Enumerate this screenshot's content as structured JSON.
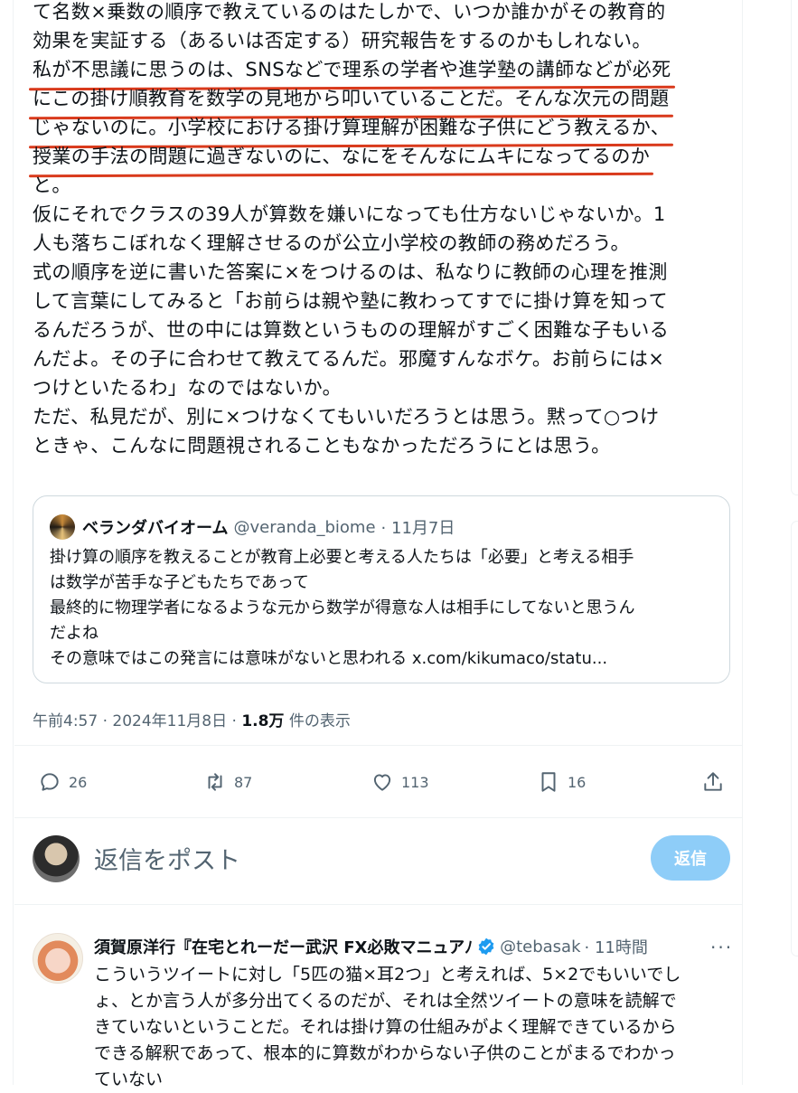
{
  "tweet": {
    "lines": [
      "て名数×乗数の順序で教えているのはたしかで、いつか誰かがその教育的",
      "効果を実証する（あるいは否定する）研究報告をするのかもしれない。",
      "私が不思議に思うのは、SNSなどで理系の学者や進学塾の講師などが必死",
      "にこの掛け順教育を数学の見地から叩いていることだ。そんな次元の問題",
      "じゃないのに。小学校における掛け算理解が困難な子供にどう教えるか、",
      "授業の手法の問題に過ぎないのに、なにをそんなにムキになってるのか",
      "と。",
      "仮にそれでクラスの39人が算数を嫌いになっても仕方ないじゃないか。1",
      "人も落ちこぼれなく理解させるのが公立小学校の教師の務めだろう。",
      "式の順序を逆に書いた答案に×をつけるのは、私なりに教師の心理を推測",
      "して言葉にしてみると「お前らは親や塾に教わってすでに掛け算を知って",
      "るんだろうが、世の中には算数というものの理解がすごく困難な子もいる",
      "んだよ。その子に合わせて教えてるんだ。邪魔すんなボケ。お前らには×",
      "つけといたるわ」なのではないか。",
      "ただ、私見だが、別に×つけなくてもいいだろうとは思う。黙って○つけ",
      "ときゃ、こんなに問題視されることもなかっただろうにとは思う。"
    ]
  },
  "quote": {
    "name": "ベランダバイオーム",
    "handle": "@veranda_biome",
    "date": "· 11月7日",
    "lines": [
      "掛け算の順序を教えることが教育上必要と考える人たちは「必要」と考える相手",
      "は数学が苦手な子どもたちであって",
      "最終的に物理学者になるような元から数学が得意な人は相手にしてないと思うん",
      "だよね",
      "その意味ではこの発言には意味がないと思われる x.com/kikumaco/statu..."
    ]
  },
  "meta": {
    "time": "午前4:57 · 2024年11月8日 · ",
    "views": "1.8万",
    "views_suffix": " 件の表示"
  },
  "actions": {
    "replies": "26",
    "retweets": "87",
    "likes": "113",
    "bookmarks": "16"
  },
  "composer": {
    "placeholder": "返信をポスト",
    "button": "返信"
  },
  "reply": {
    "name": "須賀原洋行『在宅とれーだー武沢 FX必敗マニュアﾉ",
    "handle": "@tebasak",
    "time": "· 11時間",
    "more": "···",
    "lines": [
      "こういうツイートに対し「5匹の猫×耳2つ」と考えれば、5×2でもいいでし",
      "ょ、とか言う人が多分出てくるのだが、それは全然ツイートの意味を読解で",
      "きていないということだ。それは掛け算の仕組みがよく理解できているから",
      "できる解釈であって、根本的に算数がわからない子供のことがまるでわかっ",
      "ていない"
    ]
  },
  "colors": {
    "accent": "#1d9bf0",
    "underline": "#d93a1c",
    "secondary": "#536471"
  }
}
